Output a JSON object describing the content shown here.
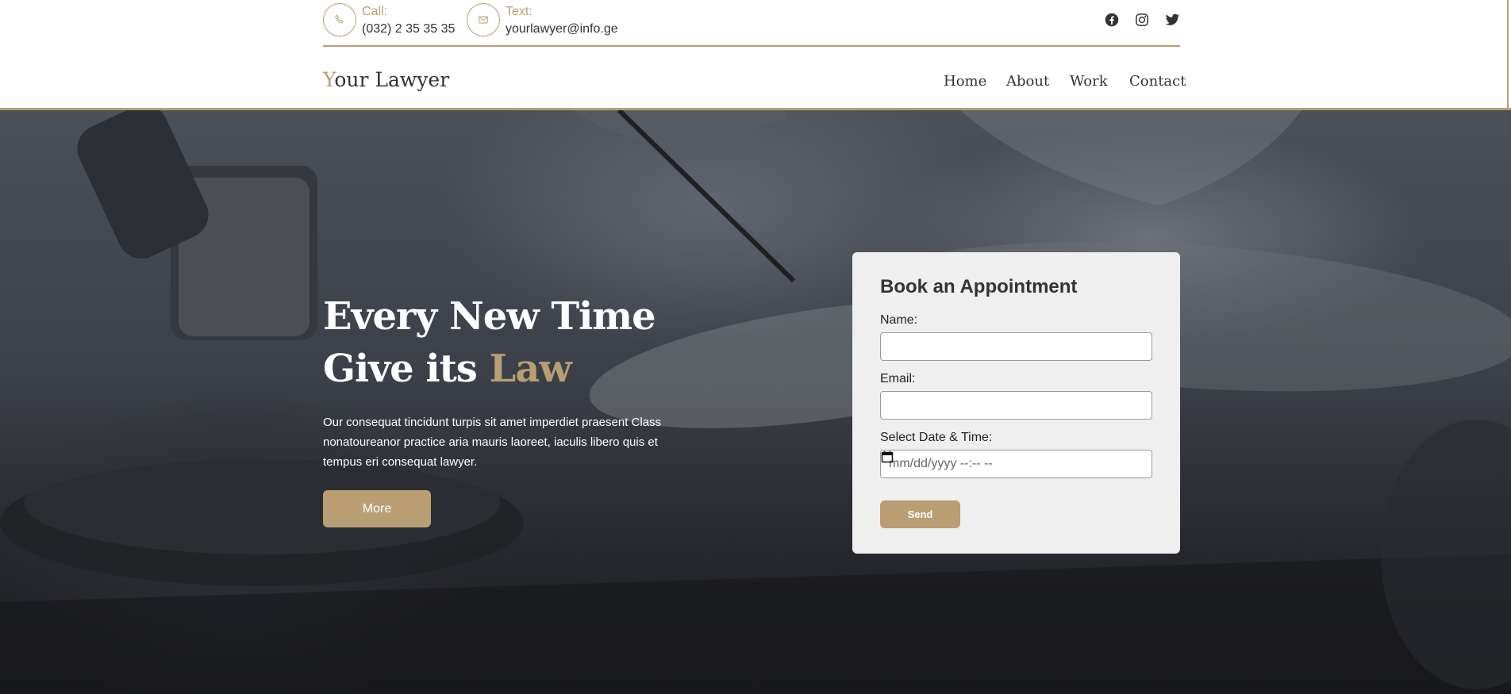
{
  "contact": {
    "call_label": "Call:",
    "call_value": "(032) 2 35 35 35",
    "text_label": "Text:",
    "text_value": "yourlawyer@info.ge"
  },
  "social": [
    {
      "icon": "facebook-icon"
    },
    {
      "icon": "instagram-icon"
    },
    {
      "icon": "twitter-icon"
    }
  ],
  "brand": {
    "first_letter": "Y",
    "rest": "our Lawyer"
  },
  "nav": [
    {
      "label": "Home"
    },
    {
      "label": "About"
    },
    {
      "label": "Work"
    },
    {
      "label": "Contact"
    }
  ],
  "hero": {
    "title_line1": "Every New Time",
    "title_line2_start": "Give its ",
    "title_line2_accent": "Law",
    "description": "Our consequat tincidunt turpis sit amet imperdiet praesent Class nonatoureanor practice aria mauris laoreet, iaculis libero quis et tempus eri consequat lawyer.",
    "button": "More"
  },
  "form": {
    "title": "Book an Appointment",
    "name_label": "Name:",
    "name_value": "",
    "email_label": "Email:",
    "email_value": "",
    "datetime_label": "Select Date & Time:",
    "datetime_placeholder": "mm/dd/yyyy --:-- --",
    "button": "Send"
  },
  "colors": {
    "accent": "#b89e72",
    "form_bg": "#efefef",
    "text_dark": "#333333"
  }
}
